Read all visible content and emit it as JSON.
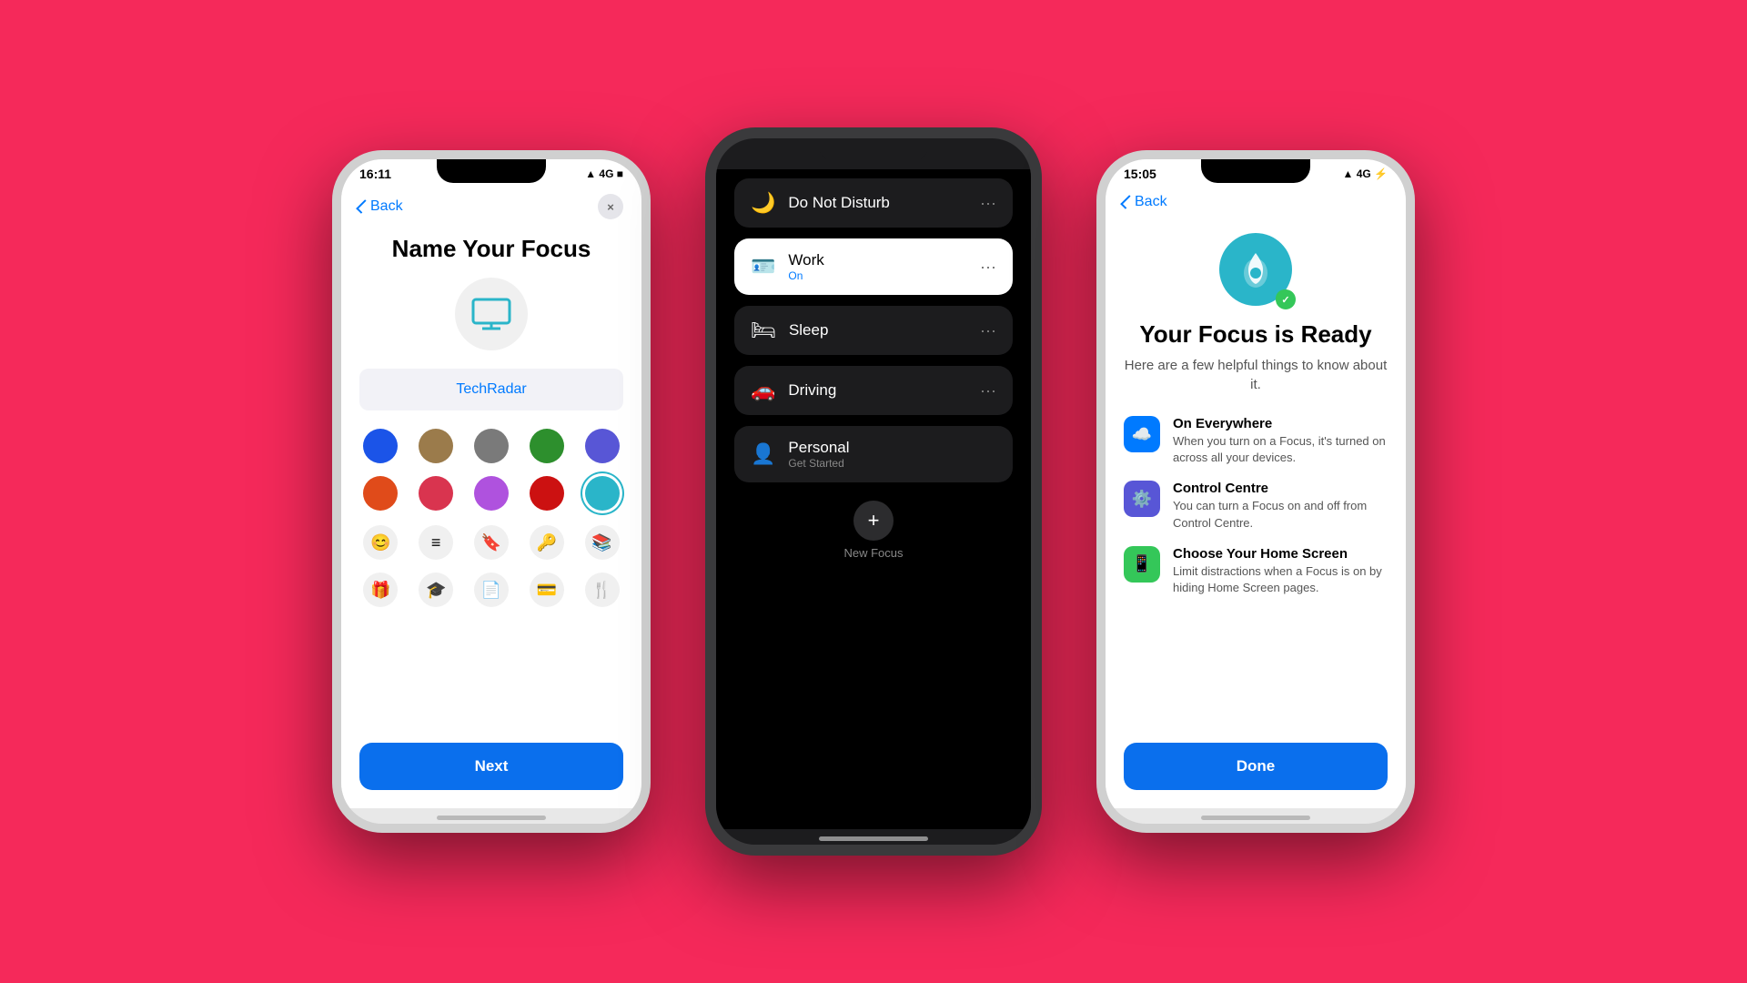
{
  "background": "#F5295A",
  "phone1": {
    "statusBar": {
      "time": "16:11",
      "icons": "▲ 4G ■"
    },
    "backLabel": "Back",
    "closeLabel": "×",
    "title": "Name Your Focus",
    "inputValue": "TechRadar",
    "inputPlaceholder": "TechRadar",
    "colors": [
      {
        "hex": "#1B54E8",
        "selected": false
      },
      {
        "hex": "#9B7B4B",
        "selected": false
      },
      {
        "hex": "#7A7A7A",
        "selected": false
      },
      {
        "hex": "#2D8F2D",
        "selected": false
      },
      {
        "hex": "#5856D6",
        "selected": false
      },
      {
        "hex": "#E04B1A",
        "selected": false
      },
      {
        "hex": "#D9344F",
        "selected": false
      },
      {
        "hex": "#AF52DE",
        "selected": false
      },
      {
        "hex": "#CC1111",
        "selected": false
      },
      {
        "hex": "#2AB5C9",
        "selected": true
      }
    ],
    "icons": [
      "😊",
      "≡",
      "🔖",
      "🔑",
      "📚",
      "🎁",
      "🎓",
      "📄",
      "💳",
      "🍴"
    ],
    "nextLabel": "Next"
  },
  "phone2": {
    "statusBar": {
      "time": "",
      "icons": ""
    },
    "items": [
      {
        "name": "Do Not Disturb",
        "sub": "",
        "icon": "🌙",
        "active": false
      },
      {
        "name": "Work",
        "sub": "On",
        "icon": "🪪",
        "active": true
      },
      {
        "name": "Sleep",
        "sub": "",
        "icon": "🛏",
        "active": false
      },
      {
        "name": "Driving",
        "sub": "",
        "icon": "🚗",
        "active": false
      },
      {
        "name": "Personal",
        "sub": "Get Started",
        "icon": "👤",
        "active": false
      }
    ],
    "addLabel": "+",
    "newFocusLabel": "New Focus"
  },
  "phone3": {
    "statusBar": {
      "time": "15:05",
      "icons": "▲ 4G ⚡"
    },
    "backLabel": "Back",
    "readyTitle": "Your Focus is Ready",
    "readySubtitle": "Here are a few helpful things to know about it.",
    "infoItems": [
      {
        "iconColor": "blue",
        "iconEmoji": "☁️",
        "title": "On Everywhere",
        "desc": "When you turn on a Focus, it's turned on across all your devices."
      },
      {
        "iconColor": "purple",
        "iconEmoji": "⚙️",
        "title": "Control Centre",
        "desc": "You can turn a Focus on and off from Control Centre."
      },
      {
        "iconColor": "green",
        "iconEmoji": "📱",
        "title": "Choose Your Home Screen",
        "desc": "Limit distractions when a Focus is on by hiding Home Screen pages."
      }
    ],
    "doneLabel": "Done"
  }
}
